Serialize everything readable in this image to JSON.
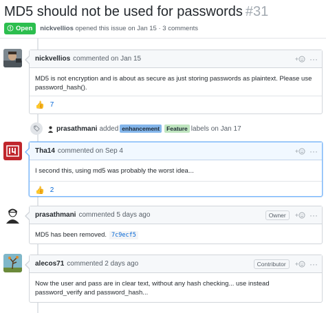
{
  "issue": {
    "title": "MD5 should not be used for passwords",
    "number": "#31",
    "state": "Open",
    "author": "nickvellios",
    "meta_text": "opened this issue on Jan 15 · 3 comments"
  },
  "colors": {
    "open_green": "#2cbe4e",
    "link_blue": "#0366d6",
    "label_enhancement": "#84b6eb",
    "label_feature": "#bfe5bf"
  },
  "comments": [
    {
      "author": "nickvellios",
      "time": "commented on Jan 15",
      "role": "",
      "body": "MD5 is not encryption and is about as secure as just storing passwords as plaintext. Please use password_hash().",
      "reaction_emoji": "👍",
      "reaction_count": "7"
    },
    {
      "author": "Tha14",
      "time": "commented on Sep 4",
      "role": "",
      "body": "I second this, using md5 was probably the worst idea...",
      "reaction_emoji": "👍",
      "reaction_count": "2"
    },
    {
      "author": "prasathmani",
      "time": "commented 5 days ago",
      "role": "Owner",
      "body": "MD5 has been removed.",
      "commit_sha": "7c9ecf5"
    },
    {
      "author": "alecos71",
      "time": "commented 2 days ago",
      "role": "Contributor",
      "body": "Now the user and pass are in clear text, without any hash checking... use instead password_verify and password_hash..."
    }
  ],
  "event": {
    "actor": "prasathmani",
    "action": "added",
    "labels": [
      "enhancement",
      "Feature"
    ],
    "suffix": "labels on Jan 17"
  },
  "icons": {
    "add_reaction": "smiley-plus-icon",
    "more": "kebab-dots-icon",
    "label_event": "tag-icon",
    "state": "issue-opened-icon"
  }
}
